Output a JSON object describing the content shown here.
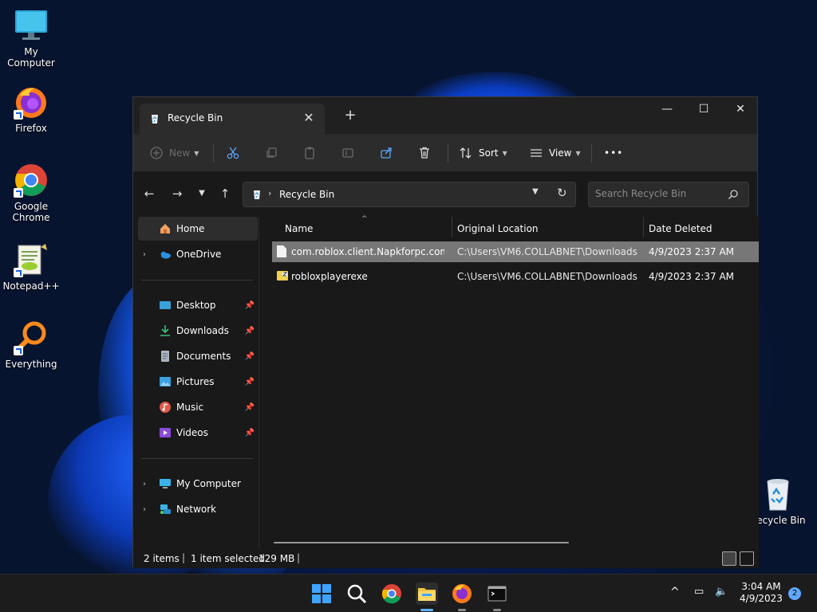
{
  "desktop": {
    "icons": [
      {
        "label": "My Computer"
      },
      {
        "label": "Firefox"
      },
      {
        "label": "Google Chrome"
      },
      {
        "label": "Notepad++"
      },
      {
        "label": "Everything"
      },
      {
        "label": "Recycle Bin"
      }
    ]
  },
  "window": {
    "tab_title": "Recycle Bin",
    "close_tab_glyph": "✕",
    "new_tab_glyph": "+",
    "controls": {
      "minimize": "—",
      "maximize": "☐",
      "close": "✕"
    }
  },
  "toolbar": {
    "new_label": "New",
    "sort_label": "Sort",
    "view_label": "View",
    "more_glyph": "•••"
  },
  "address": {
    "path": "Recycle Bin",
    "search_placeholder": "Search Recycle Bin"
  },
  "nav": {
    "home": "Home",
    "onedrive": "OneDrive",
    "quick": [
      {
        "label": "Desktop"
      },
      {
        "label": "Downloads"
      },
      {
        "label": "Documents"
      },
      {
        "label": "Pictures"
      },
      {
        "label": "Music"
      },
      {
        "label": "Videos"
      }
    ],
    "my_computer": "My Computer",
    "network": "Network"
  },
  "columns": {
    "name": "Name",
    "location": "Original Location",
    "date": "Date Deleted"
  },
  "files": [
    {
      "name": "com.roblox.client.Napkforpc.com....",
      "location": "C:\\Users\\VM6.COLLABNET\\Downloads",
      "date": "4/9/2023 2:37 AM",
      "selected": true
    },
    {
      "name": "robloxplayerexe",
      "location": "C:\\Users\\VM6.COLLABNET\\Downloads",
      "date": "4/9/2023 2:37 AM",
      "selected": false
    }
  ],
  "status": {
    "items": "2 items",
    "selected": "1 item selected",
    "size": "129 MB"
  },
  "taskbar": {
    "time": "3:04 AM",
    "date": "4/9/2023",
    "notification_count": "2"
  },
  "colors": {
    "accent": "#5fb2ff",
    "window_bg": "#191919",
    "toolbar_bg": "#2c2c2c",
    "selected_row": "#777777"
  }
}
